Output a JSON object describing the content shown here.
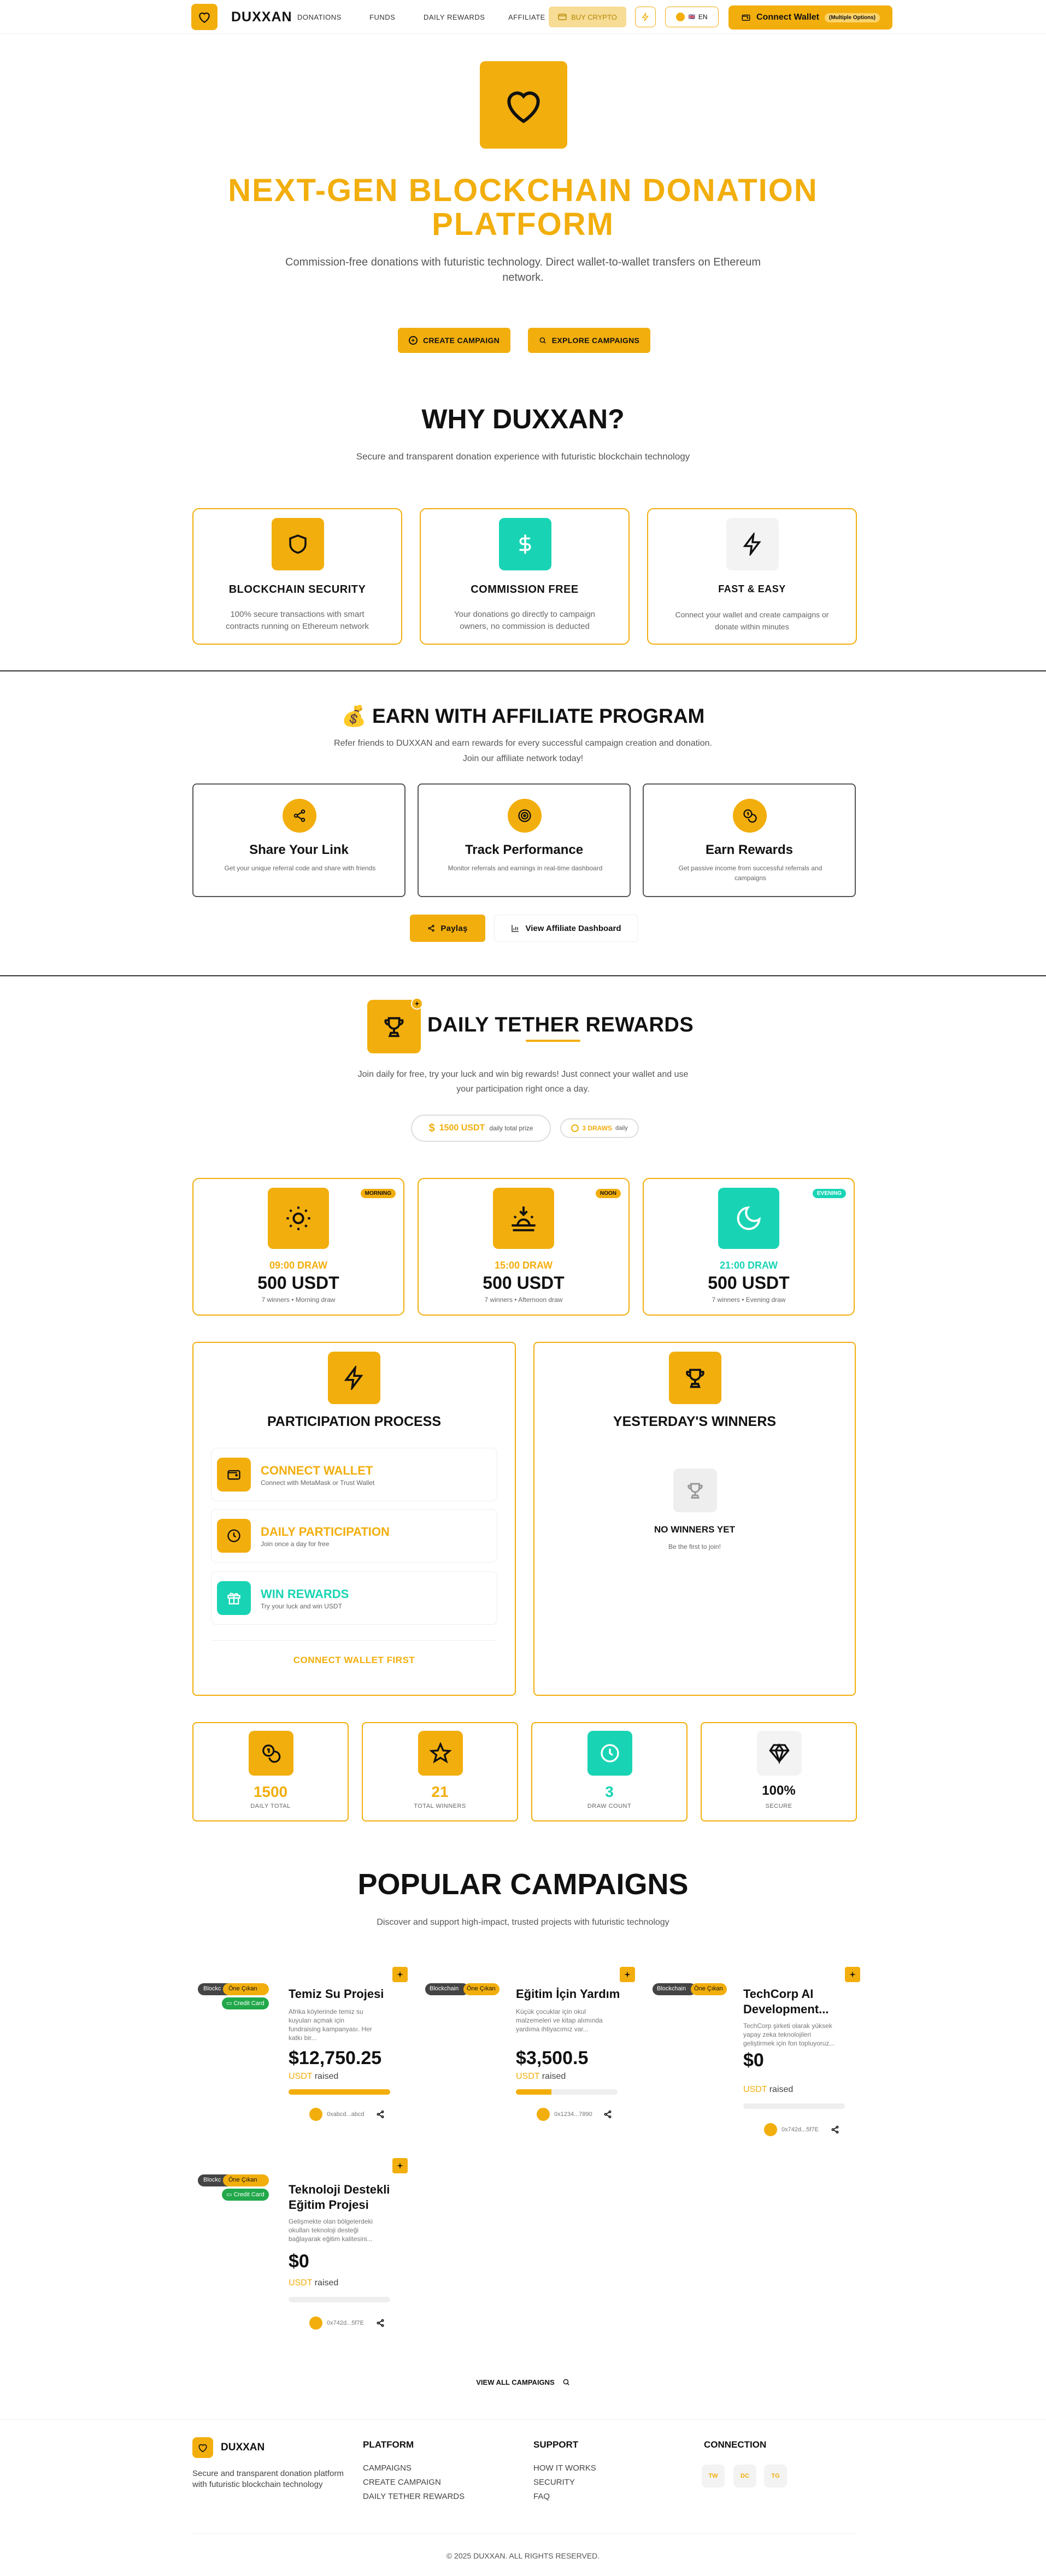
{
  "header": {
    "brand": "DUXXAN",
    "nav": [
      "DONATIONS",
      "FUNDS",
      "DAILY REWARDS",
      "AFFILIATE"
    ],
    "buy_crypto": "BUY CRYPTO",
    "lang": "EN",
    "connect_wallet": "Connect Wallet",
    "connect_badge": "(Multiple Options)"
  },
  "hero": {
    "title": "NEXT-GEN BLOCKCHAIN DONATION PLATFORM",
    "subtitle": "Commission-free donations with futuristic technology. Direct wallet-to-wallet transfers on Ethereum network.",
    "create_campaign": "CREATE CAMPAIGN",
    "explore_campaigns": "EXPLORE CAMPAIGNS"
  },
  "why": {
    "title": "WHY DUXXAN?",
    "subtitle": "Secure and transparent donation experience with futuristic blockchain technology",
    "cards": [
      {
        "title": "BLOCKCHAIN SECURITY",
        "text": "100% secure transactions with smart contracts running on Ethereum network",
        "icon": "shield-icon",
        "color": "#f2ae0d"
      },
      {
        "title": "COMMISSION FREE",
        "text": "Your donations go directly to campaign owners, no commission is deducted",
        "icon": "dollar-icon",
        "color": "#19d4b4"
      },
      {
        "title": "FAST & EASY",
        "text": "Connect your wallet and create campaigns or donate within minutes",
        "icon": "lightning-icon",
        "color": "#f3f3f3"
      }
    ]
  },
  "affiliate": {
    "title": "💰 EARN WITH AFFILIATE PROGRAM",
    "subtitle1": "Refer friends to DUXXAN and earn rewards for every successful campaign creation and donation.",
    "subtitle2": "Join our affiliate network today!",
    "cards": [
      {
        "title": "Share Your Link",
        "text": "Get your unique referral code and share with friends",
        "icon": "share-icon"
      },
      {
        "title": "Track Performance",
        "text": "Monitor referrals and earnings in real-time dashboard",
        "icon": "target-icon"
      },
      {
        "title": "Earn Rewards",
        "text": "Get passive income from successful referrals and campaigns",
        "icon": "coins-icon"
      }
    ],
    "share_btn": "Paylaş",
    "dashboard_btn": "View Affiliate Dashboard"
  },
  "rewards": {
    "title": "DAILY TETHER REWARDS",
    "subtitle1": "Join daily for free, try your luck and win big rewards! Just connect your wallet and use",
    "subtitle2": "your participation right once a day.",
    "prize": "1500 USDT",
    "prize_label": "daily total prize",
    "draws_count": "3 DRAWS",
    "draws_label": "daily",
    "draws": [
      {
        "badge": "MORNING",
        "time": "09:00 DRAW",
        "amount": "500 USDT",
        "desc": "7 winners • Morning draw",
        "icon": "sun-icon",
        "color": "#f2ae0d"
      },
      {
        "badge": "NOON",
        "time": "15:00 DRAW",
        "amount": "500 USDT",
        "desc": "7 winners • Afternoon draw",
        "icon": "sunset-icon",
        "color": "#f2ae0d"
      },
      {
        "badge": "EVENING",
        "time": "21:00 DRAW",
        "amount": "500 USDT",
        "desc": "7 winners • Evening draw",
        "icon": "moon-icon",
        "color": "#19d4b4"
      }
    ],
    "process_title": "PARTICIPATION PROCESS",
    "steps": [
      {
        "title": "CONNECT WALLET",
        "text": "Connect with MetaMask or Trust Wallet",
        "icon": "wallet-icon",
        "color": "#f2ae0d"
      },
      {
        "title": "DAILY PARTICIPATION",
        "text": "Join once a day for free",
        "icon": "clock-icon",
        "color": "#f2ae0d"
      },
      {
        "title": "WIN REWARDS",
        "text": "Try your luck and win USDT",
        "icon": "gift-icon",
        "color": "#19d4b4"
      }
    ],
    "connect_first": "CONNECT WALLET FIRST",
    "winners_title": "YESTERDAY'S WINNERS",
    "no_winners": "NO WINNERS YET",
    "be_first": "Be the first to join!",
    "stats": [
      {
        "value": "1500",
        "label": "DAILY TOTAL",
        "icon": "coins-icon",
        "color": "#f2ae0d",
        "valcolor": "#f2ae0d"
      },
      {
        "value": "21",
        "label": "TOTAL WINNERS",
        "icon": "star-icon",
        "color": "#f2ae0d",
        "valcolor": "#f2ae0d"
      },
      {
        "value": "3",
        "label": "DRAW COUNT",
        "icon": "clock-icon",
        "color": "#19d4b4",
        "valcolor": "#19d4b4"
      },
      {
        "value": "100%",
        "label": "SECURE",
        "icon": "diamond-icon",
        "color": "#f3f3f3",
        "valcolor": "#111"
      }
    ]
  },
  "campaigns": {
    "title": "POPULAR CAMPAIGNS",
    "subtitle": "Discover and support high-impact, trusted projects with futuristic technology",
    "items": [
      {
        "tag1": "Blockc",
        "tag2": "Öne Çıkan",
        "tag3": "Credit Card",
        "title": "Temiz Su Projesi",
        "desc": "Afrika köylerinde temiz su kuyuları açmak için fundraising kampanyası. Her katkı bir...",
        "amount": "$12,750.25",
        "raised_unit": "USDT",
        "raised": "raised",
        "progress": 1.0,
        "owner": "0xabcd...abcd"
      },
      {
        "tag1": "Blockchain",
        "tag2": "Öne Çıkan",
        "tag3": "",
        "title": "Eğitim İçin Yardım",
        "desc": "Küçük çocuklar için okul malzemeleri ve kitap alımında yardıma ihtiyacımız var...",
        "amount": "$3,500.5",
        "raised_unit": "USDT",
        "raised": "raised",
        "progress": 0.35,
        "owner": "0x1234...7890"
      },
      {
        "tag1": "Blockchain",
        "tag2": "Öne Çıkan",
        "tag3": "",
        "title": "TechCorp AI Development...",
        "desc": "TechCorp şirketi olarak yüksek yapay zeka teknolojileri geliştirmek için fon topluyoruz...",
        "amount": "$0",
        "raised_unit": "USDT",
        "raised": "raised",
        "progress": 0,
        "owner": "0x742d...5f7E"
      },
      {
        "tag1": "Blockc",
        "tag2": "Öne Çıkan",
        "tag3": "Credit Card",
        "title": "Teknoloji Destekli Eğitim Projesi",
        "desc": "Gelişmekte olan bölgelerdeki okulları teknoloji desteği bağlayarak eğitim kalitesini...",
        "amount": "$0",
        "raised_unit": "USDT",
        "raised": "raised",
        "progress": 0,
        "owner": "0x742d...5f7E"
      }
    ],
    "view_all": "VIEW ALL CAMPAIGNS"
  },
  "footer": {
    "brand": "DUXXAN",
    "tagline1": "Secure and transparent donation platform",
    "tagline2": "with futuristic blockchain technology",
    "platform_title": "PLATFORM",
    "platform_links": [
      "CAMPAIGNS",
      "CREATE CAMPAIGN",
      "DAILY TETHER REWARDS"
    ],
    "support_title": "SUPPORT",
    "support_links": [
      "HOW IT WORKS",
      "SECURITY",
      "FAQ"
    ],
    "connection_title": "CONNECTION",
    "social": [
      "TW",
      "DC",
      "TG"
    ],
    "copyright": "© 2025 DUXXAN. ALL RIGHTS RESERVED."
  }
}
